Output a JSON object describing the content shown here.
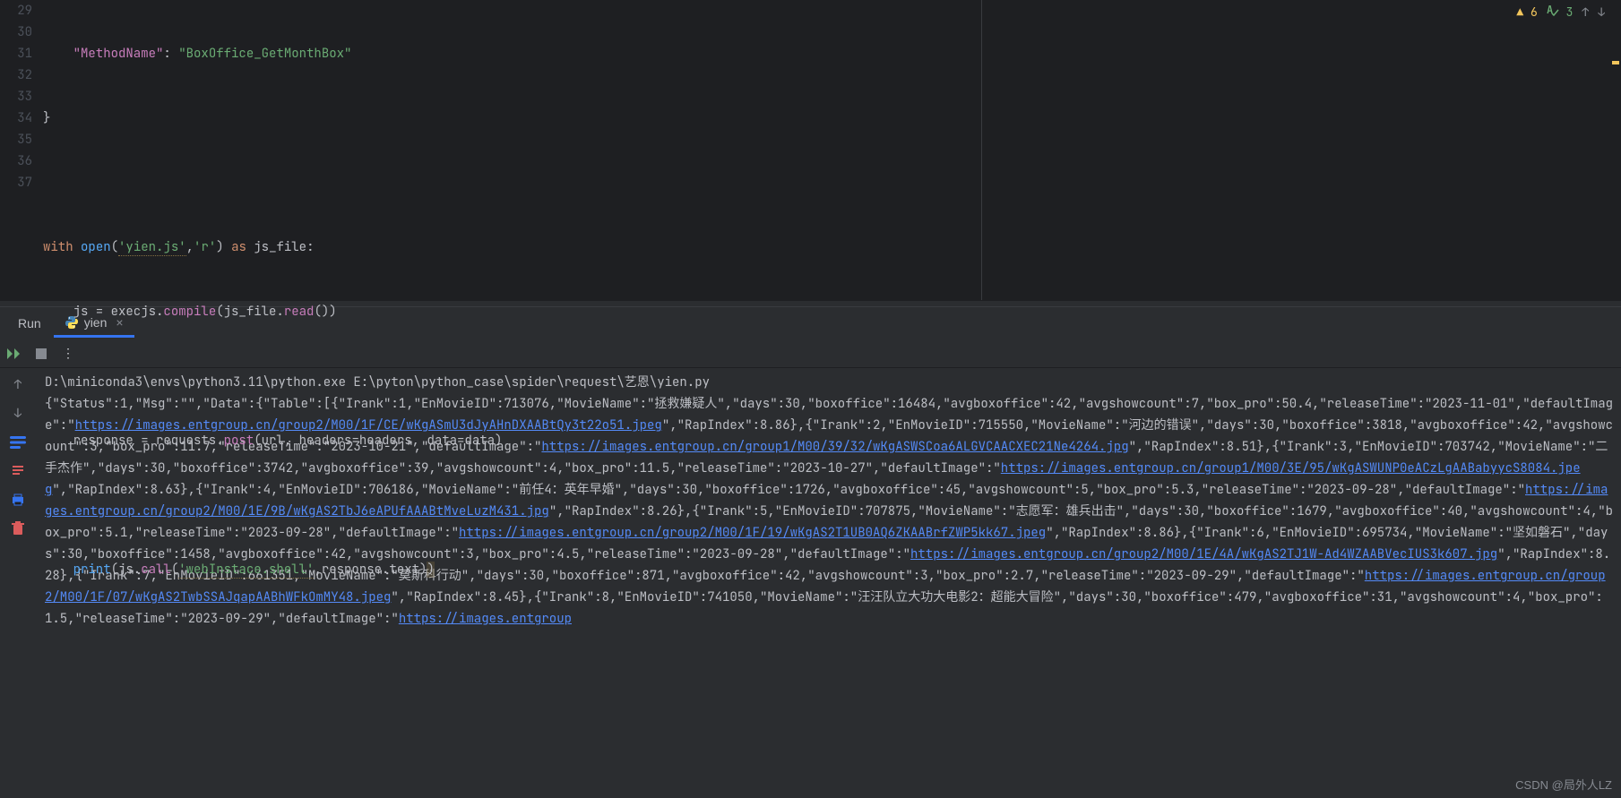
{
  "editor": {
    "lines": [
      29,
      30,
      31,
      32,
      33,
      34,
      35,
      36,
      37
    ]
  },
  "code": {
    "l29_key": "\"MethodName\"",
    "l29_val": "\"BoxOffice_GetMonthBox\"",
    "l30": "}",
    "l32_with": "with",
    "l32_open": "open",
    "l32_file": "'yien.js'",
    "l32_mode": "'r'",
    "l32_as": "as",
    "l32_var": "js_file:",
    "l33_lhs": "js = execjs.",
    "l33_compile": "compile",
    "l33_arg": "(js_file.",
    "l33_read": "read",
    "l33_end": "())",
    "l35_lhs": "response = requests.",
    "l35_post": "post",
    "l35_open": "(url, ",
    "l35_headers": "headers",
    "l35_eq1": "=headers, ",
    "l35_data": "data",
    "l35_eq2": "=data)",
    "l37_print": "print",
    "l37_open": "(js.",
    "l37_call": "call",
    "l37_arg1": "'webInstace.shell'",
    "l37_mid": ",response.text)",
    "l37_close": ")"
  },
  "indicators": {
    "warn_count": "6",
    "info_count": "3"
  },
  "run": {
    "label": "Run",
    "tab_name": "yien"
  },
  "console": {
    "cmd": "D:\\miniconda3\\envs\\python3.11\\python.exe  E:\\pyton\\python_case\\spider\\request\\艺恩\\yien.py",
    "pre1": "{\"Status\":1,\"Msg\":\"\",\"Data\":{\"Table\":[{\"Irank\":1,\"EnMovieID\":713076,\"MovieName\":\"拯救嫌疑人\",\"days\":30,\"boxoffice\":16484,\"avgboxoffice\":42,\"avgshowcount\":7,\"box_pro\":50.4,\"releaseTime\":\"2023-11-01\",\"defaultImage\":\"",
    "url1": "https://images.entgroup.cn/group2/M00/1F/CE/wKgASmU3dJyAHnDXAABtQy3t22o51.jpeg",
    "mid1": "\",\"RapIndex\":8.86},{\"Irank\":2,\"EnMovieID\":715550,\"MovieName\":\"河边的错误\",\"days\":30,\"boxoffice\":3818,\"avgboxoffice\":42,\"avgshowcount\":3,\"box_pro\":11.7,\"releaseTime\":\"2023-10-21\",\"defaultImage\":\"",
    "url2": "https://images.entgroup.cn/group1/M00/39/32/wKgASWSCoa6ALGVCAACXEC21Ne4264.jpg",
    "mid2": "\",\"RapIndex\":8.51},{\"Irank\":3,\"EnMovieID\":703742,\"MovieName\":\"二手杰作\",\"days\":30,\"boxoffice\":3742,\"avgboxoffice\":39,\"avgshowcount\":4,\"box_pro\":11.5,\"releaseTime\":\"2023-10-27\",\"defaultImage\":\"",
    "url3": "https://images.entgroup.cn/group1/M00/3E/95/wKgASWUNP0eACzLgAABabyycS8084.jpeg",
    "mid3": "\",\"RapIndex\":8.63},{\"Irank\":4,\"EnMovieID\":706186,\"MovieName\":\"前任4：英年早婚\",\"days\":30,\"boxoffice\":1726,\"avgboxoffice\":45,\"avgshowcount\":5,\"box_pro\":5.3,\"releaseTime\":\"2023-09-28\",\"defaultImage\":\"",
    "url4": "https://images.entgroup.cn/group2/M00/1E/9B/wKgAS2TbJ6eAPUfAAABtMveLuzM431.jpg",
    "mid4": "\",\"RapIndex\":8.26},{\"Irank\":5,\"EnMovieID\":707875,\"MovieName\":\"志愿军：雄兵出击\",\"days\":30,\"boxoffice\":1679,\"avgboxoffice\":40,\"avgshowcount\":4,\"box_pro\":5.1,\"releaseTime\":\"2023-09-28\",\"defaultImage\":\"",
    "url5": "https://images.entgroup.cn/group2/M00/1F/19/wKgAS2T1UB0AQ6ZKAABrfZWP5kk67.jpeg",
    "mid5": "\",\"RapIndex\":8.86},{\"Irank\":6,\"EnMovieID\":695734,\"MovieName\":\"坚如磐石\",\"days\":30,\"boxoffice\":1458,\"avgboxoffice\":42,\"avgshowcount\":3,\"box_pro\":4.5,\"releaseTime\":\"2023-09-28\",\"defaultImage\":\"",
    "url6": "https://images.entgroup.cn/group2/M00/1E/4A/wKgAS2TJ1W-Ad4WZAABVecIUS3k607.jpg",
    "mid6": "\",\"RapIndex\":8.28},{\"Irank\":7,\"EnMovieID\":661351,\"MovieName\":\"莫斯科行动\",\"days\":30,\"boxoffice\":871,\"avgboxoffice\":42,\"avgshowcount\":3,\"box_pro\":2.7,\"releaseTime\":\"2023-09-29\",\"defaultImage\":\"",
    "url7": "https://images.entgroup.cn/group2/M00/1F/07/wKgAS2TwbSSAJqapAABhWFkOmMY48.jpeg",
    "mid7": "\",\"RapIndex\":8.45},{\"Irank\":8,\"EnMovieID\":741050,\"MovieName\":\"汪汪队立大功大电影2：超能大冒险\",\"days\":30,\"boxoffice\":479,\"avgboxoffice\":31,\"avgshowcount\":4,\"box_pro\":1.5,\"releaseTime\":\"2023-09-29\",\"defaultImage\":\"",
    "url8": "https://images.entgroup"
  },
  "watermark": "CSDN @局外人LZ"
}
